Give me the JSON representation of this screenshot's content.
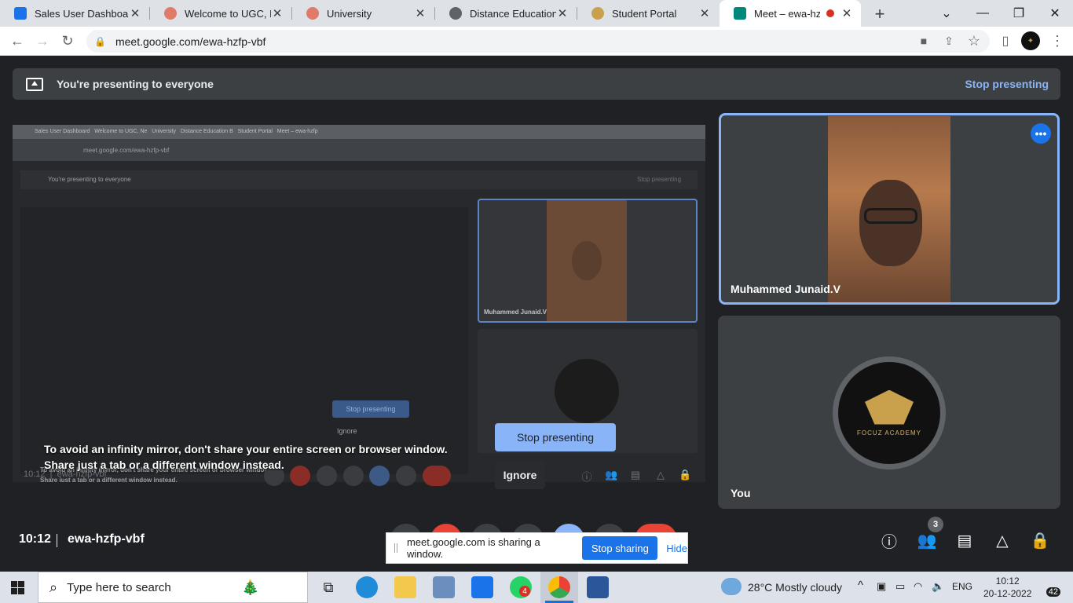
{
  "browser": {
    "tabs": [
      {
        "title": "Sales User Dashboard",
        "color": "#1a73e8"
      },
      {
        "title": "Welcome to UGC, New",
        "color": "#e07b6a"
      },
      {
        "title": "University",
        "color": "#e07b6a"
      },
      {
        "title": "Distance Education Bu",
        "color": "#5f6368"
      },
      {
        "title": "Student Portal",
        "color": "#c9a04b"
      },
      {
        "title": "Meet – ewa-hzfp-",
        "color": "#00897b"
      }
    ],
    "url": "meet.google.com/ewa-hzfp-vbf"
  },
  "meet": {
    "banner_text": "You're presenting to everyone",
    "banner_stop": "Stop presenting",
    "warning_line1": "To avoid an infinity mirror, don't share your entire screen or browser window.",
    "warning_line2": "Share just a tab or a different window instead.",
    "stop_presenting_button": "Stop presenting",
    "ignore_button": "Ignore",
    "participant_main": "Muhammed Junaid.V",
    "participant_you": "You",
    "you_logo_text": "FOCUZ ACADEMY",
    "time": "10:12",
    "meeting_code": "ewa-hzfp-vbf",
    "people_count": "3",
    "share_notice": "meet.google.com is sharing a window.",
    "stop_sharing_button": "Stop sharing",
    "hide_link": "Hide",
    "accent": "#8ab4f8"
  },
  "mirror": {
    "tabs": "Sales User Dashboard   Welcome to UGC, Ne   University   Distance Education B   Student Portal   Meet – ewa-hzfp",
    "url": "meet.google.com/ewa-hzfp-vbf",
    "banner_text": "You're presenting to everyone",
    "banner_stop": "Stop presenting",
    "participant": "Muhammed Junaid.V",
    "stop_presenting": "Stop presenting",
    "ignore": "Ignore",
    "warning_line1": "To avoid an infinity mirror, don't share your entire screen or browser window.",
    "warning_line2": "Share just a tab or a different window instead.",
    "time": "10:12",
    "code": "ewa-hzfp-vbf"
  },
  "taskbar": {
    "search_placeholder": "Type here to search",
    "weather": "28°C  Mostly cloudy",
    "lang": "ENG",
    "clock_time": "10:12",
    "clock_date": "20-12-2022",
    "whatsapp_badge": "4",
    "notifications": "42"
  }
}
